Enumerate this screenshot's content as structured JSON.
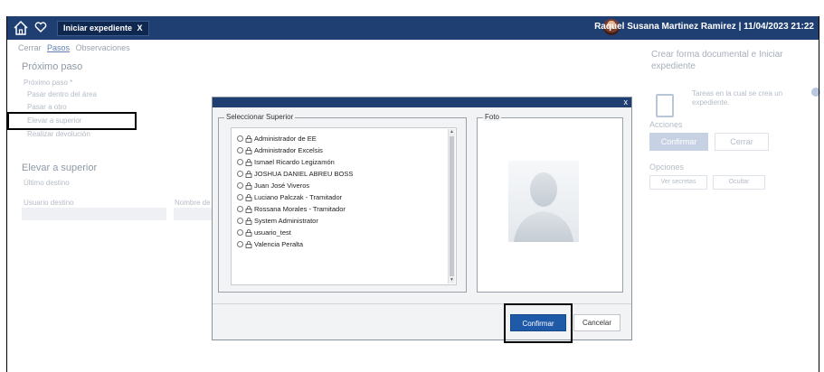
{
  "topbar": {
    "tab_label": "Iniciar expediente",
    "tab_close": "X",
    "user_info": "Raquel Susana Martinez Ramirez | 11/04/2023 21:22"
  },
  "background": {
    "subtabs": [
      "Cerrar",
      "Pasos",
      "Observaciones"
    ],
    "next_step_title": "Próximo paso",
    "next_step_label": "Próximo paso *",
    "radio_options": [
      "Pasar dentro del área",
      "Pasar a otro",
      "Elevar a superior",
      "Realizar devolución"
    ],
    "elevate_title": "Elevar a superior",
    "field_label_1": "Último destino",
    "field_label_2": "Usuario destino",
    "field_label_3": "Nombre de usuario",
    "right_title": "Crear forma documental e Iniciar expediente",
    "doc_text": "Tareas en la cual se crea un expediente.",
    "actions_label": "Acciones",
    "confirm_label": "Confirmar",
    "close_label": "Cerrar",
    "options_label": "Opciones",
    "option_buttons": [
      "Ver secretas",
      "Ocultar"
    ]
  },
  "modal": {
    "close_symbol": "x",
    "superior_legend": "Seleccionar Superior",
    "photo_legend": "Foto",
    "users": [
      "Administrador de EE",
      "Administrador Excelsis",
      "Ismael Ricardo Legizamón",
      "JOSHUA DANIEL ABREU BOSS",
      "Juan José Viveros",
      "Luciano Palczak - Tramitador",
      "Rossana Morales - Tramitador",
      "System Administrator",
      "usuario_test",
      "Valencia Peralta"
    ],
    "confirm_button": "Confirmar",
    "cancel_button": "Cancelar"
  },
  "colors": {
    "header": "#1f3f72",
    "primary": "#1f5aa8"
  }
}
